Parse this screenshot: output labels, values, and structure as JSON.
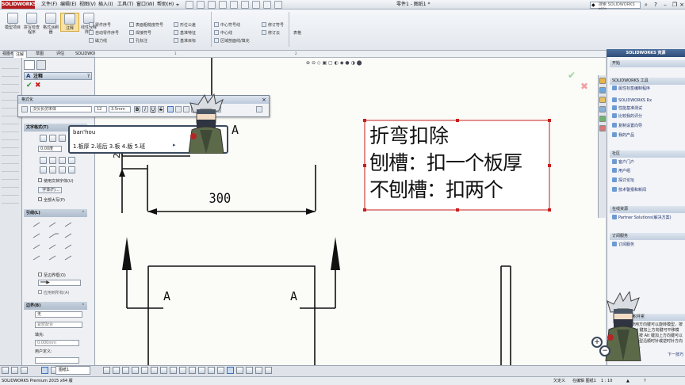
{
  "app": {
    "logo": "SOLIDWORKS",
    "menus": [
      "文件(F)",
      "编辑(E)",
      "视图(V)",
      "插入(I)",
      "工具(T)",
      "窗口(W)",
      "帮助(H)"
    ],
    "doc_title": "零件1 - 图纸1 *",
    "help_search_placeholder": "搜索 SOLIDWORKS 帮助"
  },
  "ribbon": {
    "big_buttons": [
      "模型项目",
      "拼写检查程序",
      "格式涂刷器",
      "注释",
      "线性注释阵列"
    ],
    "col1": [
      "零件序号",
      "自动零件序号",
      "磁力线"
    ],
    "col2": [
      "表面粗糙度符号",
      "焊接符号",
      "孔标注"
    ],
    "col3": [
      "形位公差",
      "基准特征",
      "基准目标"
    ],
    "col4": [
      "中心符号线",
      "中心线",
      "区域剖面线/填充"
    ],
    "col5": [
      "修订符号",
      "修订云"
    ],
    "table_label": "表格"
  },
  "tabs": [
    "视图布局",
    "注解",
    "草图",
    "评估",
    "SOLIDWORKS 插件"
  ],
  "ruler": {
    "labels": [
      "1",
      "2"
    ]
  },
  "property_manager": {
    "title": "注释",
    "sections": {
      "format": "格式化",
      "text_format": "文字格式(T)",
      "leader": "引线(L)",
      "border": "边界(B)"
    },
    "angle_value": "0.00度",
    "use_doc_font": "使用文档字体(U)",
    "font_button": "字体(F)...",
    "all_caps": "全部大写(P)",
    "to_border": "至边界框(O)",
    "apply_all": "应用到所有(A)",
    "border_style": "无",
    "border_fit": "紧密配合",
    "fill_label": "填充:",
    "fill_value": "0.000mm",
    "user_defined_label": "用户定义:"
  },
  "format_toolbar": {
    "title": "格式化",
    "font": "汉仪长仿宋体",
    "size": "12",
    "height": "3.5mm",
    "bold": "B",
    "italic": "I",
    "underline": "U",
    "strike": "S"
  },
  "ime": {
    "composition": "ban'hou",
    "candidates": "1.板厚  2.班后  3.板  4.版  5.班"
  },
  "drawing": {
    "note_lines": [
      "折弯扣除",
      "刨槽：扣一个板厚",
      "不刨槽：扣两个"
    ],
    "dimension": "300",
    "section_label": "A",
    "partial_num": "2"
  },
  "task_pane": {
    "title": "SOLIDWORKS 资源",
    "sections": [
      {
        "title": "开始",
        "items": []
      },
      {
        "title": "SOLIDWORKS 工具",
        "items": [
          "属性标签编制程序",
          "SOLIDWORKS Rx",
          "性能基准测试",
          "比较我的评分",
          "复制设置向导",
          "我的产品"
        ]
      },
      {
        "title": "社区",
        "items": [
          "客户门户",
          "用户组",
          "探讨论坛",
          "技术警报和新闻"
        ]
      },
      {
        "title": "在线资源",
        "items": [
          "Partner Solutions(解决方案)"
        ]
      },
      {
        "title": "订阅服务",
        "items": [
          "订阅服务"
        ]
      },
      {
        "title": "日积月累",
        "items": []
      }
    ],
    "tip_text": "使用方向键可以旋转模型，按 Ctrl 键加上方向键可平移模型，按 Alt 键加上方向键可以将模型沿顺时针或逆时针方向旋转。",
    "tip_next": "下一技巧"
  },
  "statusbar": {
    "left": "SOLIDWORKS Premium 2015 x64 版",
    "middle": "欠定义",
    "editing": "在编辑 图纸1",
    "scale": "1 : 10"
  },
  "colors": {
    "accent": "#b41e1e",
    "link": "#1c2f6e",
    "selection": "#c81e1e"
  }
}
